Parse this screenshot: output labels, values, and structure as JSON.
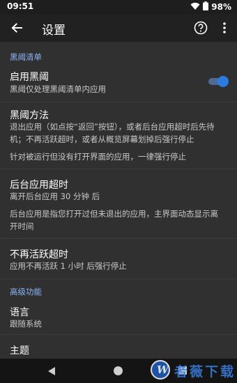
{
  "status_bar": {
    "time": "09:51",
    "battery": "98%"
  },
  "app_bar": {
    "title": "设置"
  },
  "sections": [
    {
      "header": "黑阈清单"
    },
    {
      "header": "高级功能"
    }
  ],
  "items": {
    "enable": {
      "title": "启用黑阈",
      "summary": "黑阈仅处理黑阈清单内应用",
      "toggle_on": true
    },
    "method": {
      "title": "黑阈方法",
      "summary_line1": "退出应用（如点按“返回”按钮），或者后台应用超时后先待",
      "summary_line2": "机；不再活跃超时，或者从概览屏幕划掉后强行停止",
      "note": "针对被运行但没有打开界面的应用，一律强行停止"
    },
    "background_timeout": {
      "title": "后台应用超时",
      "summary": "离开后台应用 30 分钟 后",
      "note_line1": "后台应用是指您打开过但未退出的应用，主界面动态显示离",
      "note_line2": "开时间"
    },
    "inactive_timeout": {
      "title": "不再活跃超时",
      "summary": "应用不再活跃 1 小时 后强行停止"
    },
    "language": {
      "title": "语言",
      "summary": "跟随系统"
    },
    "theme": {
      "title": "主题"
    }
  },
  "watermark": {
    "text": "者薇下载"
  },
  "colors": {
    "accent": "#8ab4f8",
    "toggle_on": "#2d7be0",
    "background": "#303030",
    "app_bar": "#212121"
  }
}
